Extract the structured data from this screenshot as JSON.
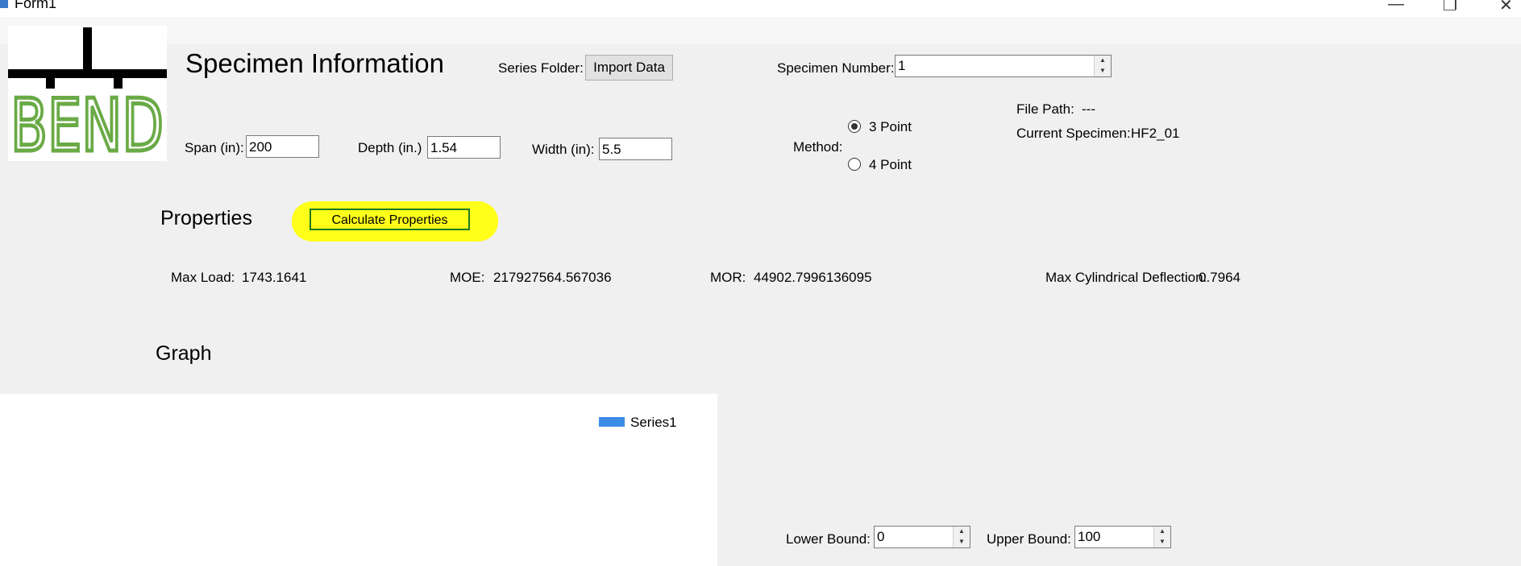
{
  "window": {
    "title": "Form1",
    "controls": {
      "minimize": "—",
      "maximize": "❐",
      "close": "✕"
    }
  },
  "logo": {
    "text": "BEND",
    "color": "#6aaa46"
  },
  "specimen": {
    "heading": "Specimen Information",
    "series_folder_label": "Series Folder:",
    "import_button": "Import Data",
    "specimen_number_label": "Specimen Number:",
    "specimen_number_value": "1",
    "span_label": "Span (in):",
    "span_value": "200",
    "depth_label": "Depth (in.)",
    "depth_value": "1.54",
    "width_label": "Width (in):",
    "width_value": "5.5",
    "method_label": "Method:",
    "method_options": [
      {
        "label": "3 Point",
        "selected": true
      },
      {
        "label": "4 Point",
        "selected": false
      }
    ],
    "file_path_label": "File Path:",
    "file_path_value": "---",
    "current_specimen_label": "Current Specimen:",
    "current_specimen_value": "HF2_01"
  },
  "properties": {
    "heading": "Properties",
    "calculate_button": "Calculate Properties",
    "highlight_color": "#ffff1a",
    "max_load_label": "Max Load:",
    "max_load_value": "1743.1641",
    "moe_label": "MOE:",
    "moe_value": "217927564.567036",
    "mor_label": "MOR:",
    "mor_value": "44902.7996136095",
    "max_deflection_label": "Max Cylindrical Deflection:",
    "max_deflection_value": "0.7964"
  },
  "graph": {
    "heading": "Graph",
    "legend": [
      {
        "name": "Series1",
        "color": "#3c8ce6"
      }
    ],
    "lower_bound_label": "Lower Bound:",
    "lower_bound_value": "0",
    "upper_bound_label": "Upper Bound:",
    "upper_bound_value": "100"
  }
}
